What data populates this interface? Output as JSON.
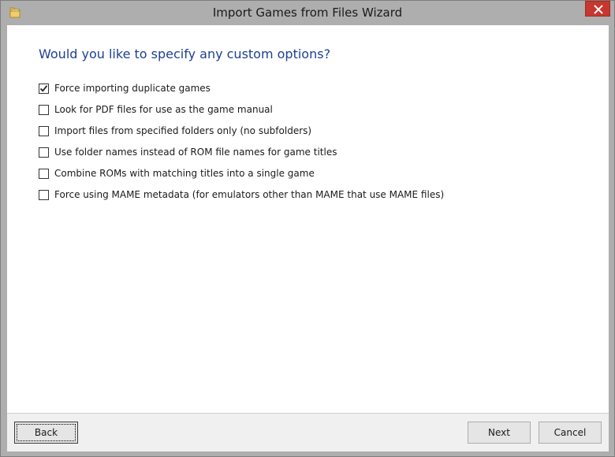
{
  "window": {
    "title": "Import Games from Files Wizard"
  },
  "page": {
    "heading": "Would you like to specify any custom options?"
  },
  "options": [
    {
      "label": "Force importing duplicate games",
      "checked": true
    },
    {
      "label": "Look for PDF files for use as the game manual",
      "checked": false
    },
    {
      "label": "Import files from specified folders only (no subfolders)",
      "checked": false
    },
    {
      "label": "Use folder names instead of ROM file names for game titles",
      "checked": false
    },
    {
      "label": "Combine ROMs with matching titles into a single game",
      "checked": false
    },
    {
      "label": "Force using MAME metadata (for emulators other than MAME that use MAME files)",
      "checked": false
    }
  ],
  "buttons": {
    "back": "Back",
    "next": "Next",
    "cancel": "Cancel"
  },
  "icons": {
    "app": "folder-icon",
    "close": "close-icon",
    "check": "checkmark-icon"
  },
  "colors": {
    "heading": "#1e3f93",
    "close_button": "#c7372f",
    "titlebar": "#aeaeae"
  }
}
